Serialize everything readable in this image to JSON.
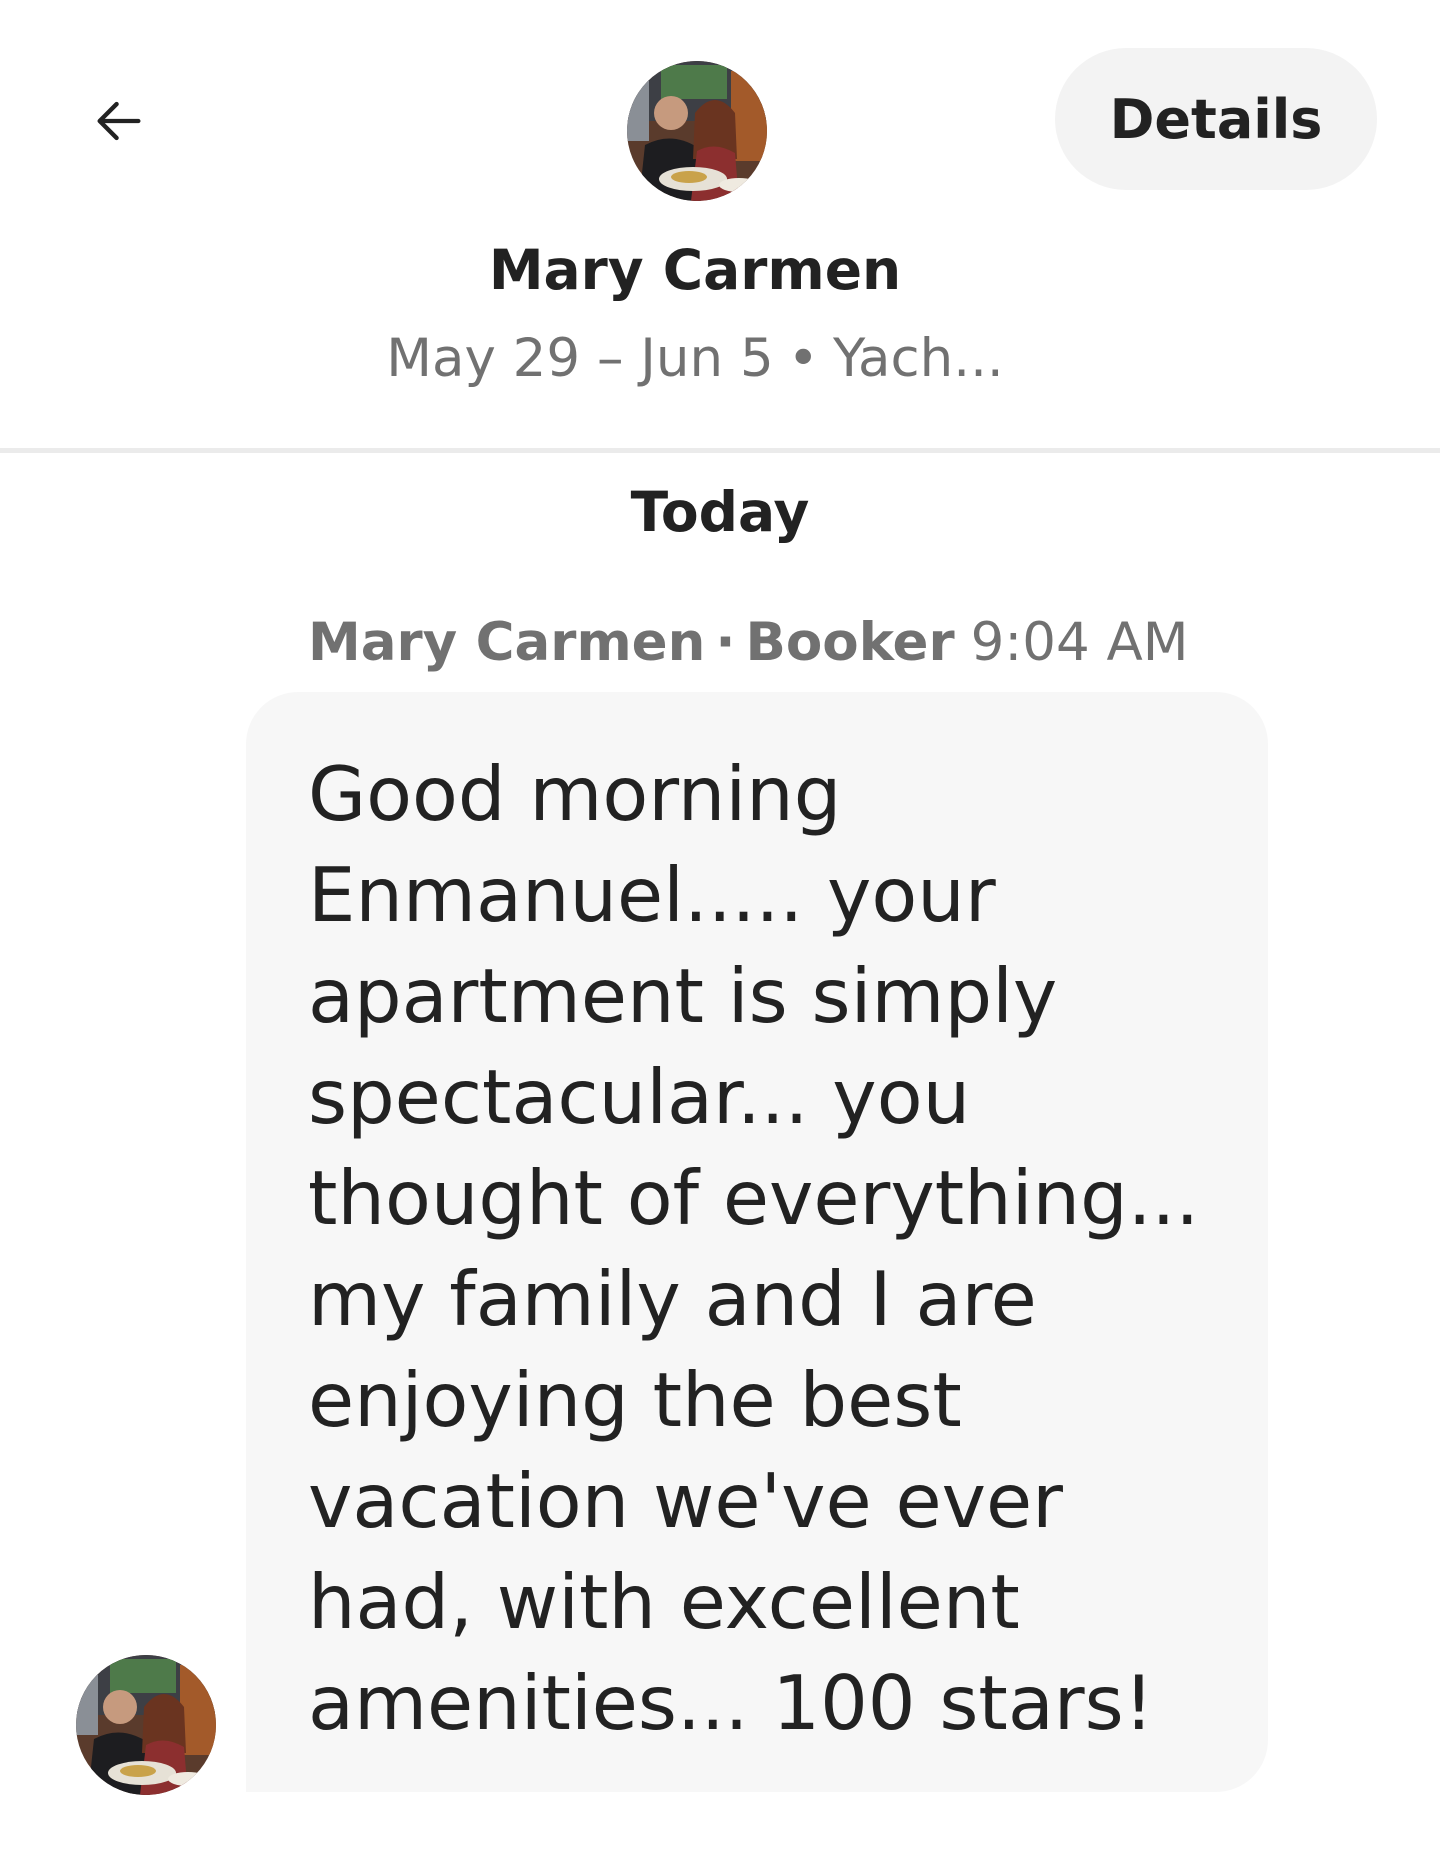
{
  "header": {
    "back_icon": "arrow-left-icon",
    "contact_name": "Mary Carmen",
    "trip_dates": "May 29 – Jun 5",
    "trip_separator": "•",
    "trip_listing": "Yach...",
    "details_label": "Details"
  },
  "thread": {
    "day_label": "Today",
    "messages": [
      {
        "sender": "Mary Carmen",
        "separator": "·",
        "role": "Booker",
        "time": "9:04 AM",
        "text": "Good morning\nEnmanuel..... your\napartment is simply\nspectacular... you\nthought of everything...\nmy family and I are\nenjoying the best\nvacation we've ever\nhad, with excellent\namenities... 100 stars!"
      }
    ]
  },
  "colors": {
    "primary_text": "#222222",
    "secondary_text": "#717171",
    "bubble_background": "#f7f7f7",
    "pill_background": "#f3f3f3",
    "divider": "#ebebeb"
  }
}
